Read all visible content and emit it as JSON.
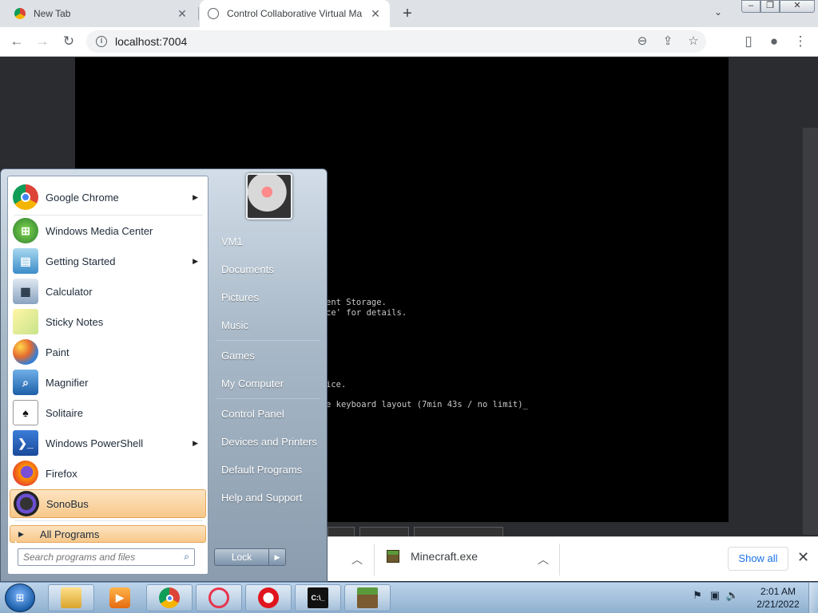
{
  "browser": {
    "tabs": [
      {
        "title": "New Tab",
        "icon": "chrome-icon"
      },
      {
        "title": "Control Collaborative Virtual Ma",
        "icon": "globe-icon"
      }
    ],
    "url": "localhost:7004"
  },
  "vm_console": {
    "lines": [
      "ent Storage.",
      "ce' for details.",
      "ice.",
      "e keyboard layout (7min 43s / no limit)_"
    ]
  },
  "downloads": {
    "item": "Minecraft.exe",
    "show_all": "Show all"
  },
  "start_menu": {
    "programs": [
      {
        "label": "Google Chrome",
        "submenu": true
      },
      {
        "label": "Windows Media Center",
        "submenu": false
      },
      {
        "label": "Getting Started",
        "submenu": true
      },
      {
        "label": "Calculator",
        "submenu": false
      },
      {
        "label": "Sticky Notes",
        "submenu": false
      },
      {
        "label": "Paint",
        "submenu": false
      },
      {
        "label": "Magnifier",
        "submenu": false
      },
      {
        "label": "Solitaire",
        "submenu": false
      },
      {
        "label": "Windows PowerShell",
        "submenu": true
      },
      {
        "label": "Firefox",
        "submenu": false
      },
      {
        "label": "SonoBus",
        "submenu": false
      }
    ],
    "all_programs": "All Programs",
    "search_placeholder": "Search programs and files",
    "right_items": [
      "VM1",
      "Documents",
      "Pictures",
      "Music",
      "Games",
      "My Computer",
      "Control Panel",
      "Devices and Printers",
      "Default Programs",
      "Help and Support"
    ],
    "lock": "Lock"
  },
  "taskbar": {
    "apps": [
      "explorer-icon",
      "media-player-icon",
      "chrome-icon",
      "opera-gx-icon",
      "opera-icon",
      "cmd-icon",
      "minecraft-icon"
    ],
    "time": "2:01 AM",
    "date": "2/21/2022"
  }
}
